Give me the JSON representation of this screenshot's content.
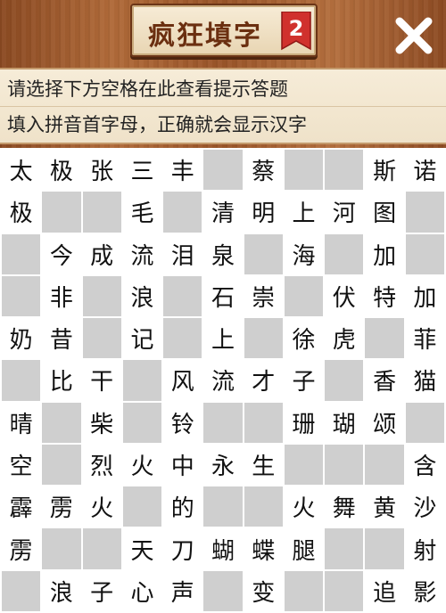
{
  "header": {
    "title": "疯狂填字",
    "level": "2",
    "colors": {
      "badge": "#d0312d",
      "title": "#6b2f10"
    }
  },
  "hints": {
    "line1": "请选择下方空格在此查看提示答题",
    "line2": "填入拼音首字母，正确就会显示汉字"
  },
  "grid": {
    "rows": [
      [
        "太",
        "极",
        "张",
        "三",
        "丰",
        "",
        "蔡",
        "",
        "",
        "斯",
        "诺"
      ],
      [
        "极",
        "",
        "",
        "毛",
        "",
        "清",
        "明",
        "上",
        "河",
        "图",
        ""
      ],
      [
        "",
        "今",
        "成",
        "流",
        "泪",
        "泉",
        "",
        "海",
        "",
        "加",
        ""
      ],
      [
        "",
        "非",
        "",
        "浪",
        "",
        "石",
        "崇",
        "",
        "伏",
        "特",
        "加"
      ],
      [
        "奶",
        "昔",
        "",
        "记",
        "",
        "上",
        "",
        "徐",
        "虎",
        "",
        "菲"
      ],
      [
        "",
        "比",
        "干",
        "",
        "风",
        "流",
        "才",
        "子",
        "",
        "香",
        "猫"
      ],
      [
        "晴",
        "",
        "柴",
        "",
        "铃",
        "",
        "",
        "珊",
        "瑚",
        "颂",
        ""
      ],
      [
        "空",
        "",
        "烈",
        "火",
        "中",
        "永",
        "生",
        "",
        "",
        "",
        "含"
      ],
      [
        "霹",
        "雳",
        "火",
        "",
        "的",
        "",
        "",
        "火",
        "舞",
        "黄",
        "沙"
      ],
      [
        "雳",
        "",
        "",
        "天",
        "刀",
        "蝴",
        "蝶",
        "腿",
        "",
        "",
        "射"
      ],
      [
        "",
        "浪",
        "子",
        "心",
        "声",
        "",
        "变",
        "",
        "",
        "追",
        "影"
      ]
    ]
  }
}
